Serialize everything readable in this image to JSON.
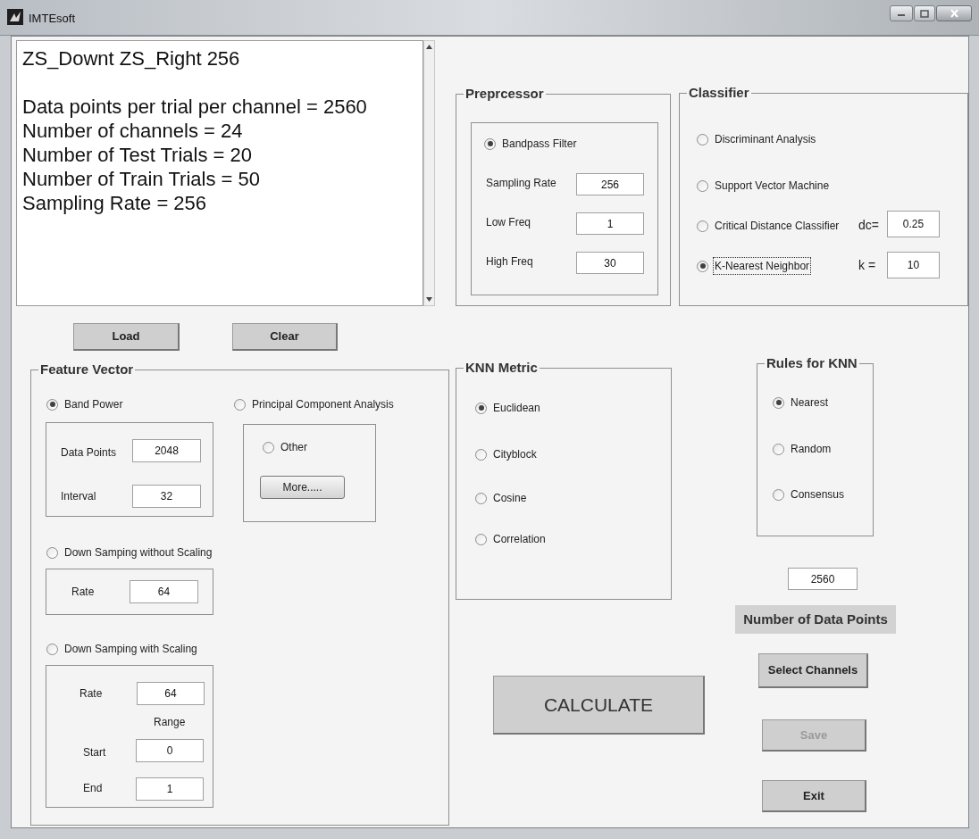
{
  "window": {
    "title": "IMTEsoft"
  },
  "info": {
    "heading": "ZS_Downt ZS_Right 256",
    "lines": [
      "Data points per trial per channel = 2560",
      "Number of channels = 24",
      "Number of Test Trials = 20",
      "Number of Train Trials = 50",
      "Sampling Rate = 256"
    ]
  },
  "preprocessor": {
    "title": "Preprcessor",
    "option": {
      "label": "Bandpass Filter",
      "selected": true
    },
    "fields": [
      {
        "label": "Sampling Rate",
        "value": "256"
      },
      {
        "label": "Low Freq",
        "value": "1"
      },
      {
        "label": "High Freq",
        "value": "30"
      }
    ]
  },
  "classifier": {
    "title": "Classifier",
    "options": [
      {
        "label": "Discriminant Analysis",
        "selected": false,
        "focused": false
      },
      {
        "label": "Support Vector Machine",
        "selected": false,
        "focused": false
      },
      {
        "label": "Critical Distance Classifier",
        "selected": false,
        "focused": false,
        "param_label": "dc=",
        "param_value": "0.25"
      },
      {
        "label": "K-Nearest Neighbor",
        "selected": true,
        "focused": true,
        "param_label": "k =",
        "param_value": "10"
      }
    ]
  },
  "top_buttons": [
    {
      "label": "Load"
    },
    {
      "label": "Clear"
    }
  ],
  "feature_vector": {
    "title": "Feature Vector",
    "band_power": {
      "label": "Band Power",
      "selected": true,
      "fields": [
        {
          "label": "Data Points",
          "value": "2048"
        },
        {
          "label": "Interval",
          "value": "32"
        }
      ]
    },
    "pca": {
      "label": "Principal Component Analysis",
      "selected": false,
      "other": {
        "label": "Other",
        "selected": false
      },
      "button": "More....."
    },
    "down_no_scaling": {
      "label": "Down Samping without Scaling",
      "selected": false,
      "fields": [
        {
          "label": "Rate",
          "value": "64"
        }
      ]
    },
    "down_scaling": {
      "label": "Down Samping with Scaling",
      "selected": false,
      "rate": {
        "label": "Rate",
        "value": "64"
      },
      "range_label": "Range",
      "fields": [
        {
          "label": "Start",
          "value": "0"
        },
        {
          "label": "End",
          "value": "1"
        }
      ]
    }
  },
  "knn_metric": {
    "title": "KNN Metric",
    "options": [
      {
        "label": "Euclidean",
        "selected": true
      },
      {
        "label": "Cityblock",
        "selected": false
      },
      {
        "label": "Cosine",
        "selected": false
      },
      {
        "label": "Correlation",
        "selected": false
      }
    ]
  },
  "rules": {
    "title": "Rules for KNN",
    "options": [
      {
        "label": "Nearest",
        "selected": true
      },
      {
        "label": "Random",
        "selected": false
      },
      {
        "label": "Consensus",
        "selected": false
      }
    ]
  },
  "data_points": {
    "value": "2560",
    "label": "Number of Data Points"
  },
  "calculate_button": {
    "label": "CALCULATE"
  },
  "side_buttons": [
    {
      "label": "Select Channels",
      "disabled": false
    },
    {
      "label": "Save",
      "disabled": true
    },
    {
      "label": "Exit",
      "disabled": false
    }
  ]
}
